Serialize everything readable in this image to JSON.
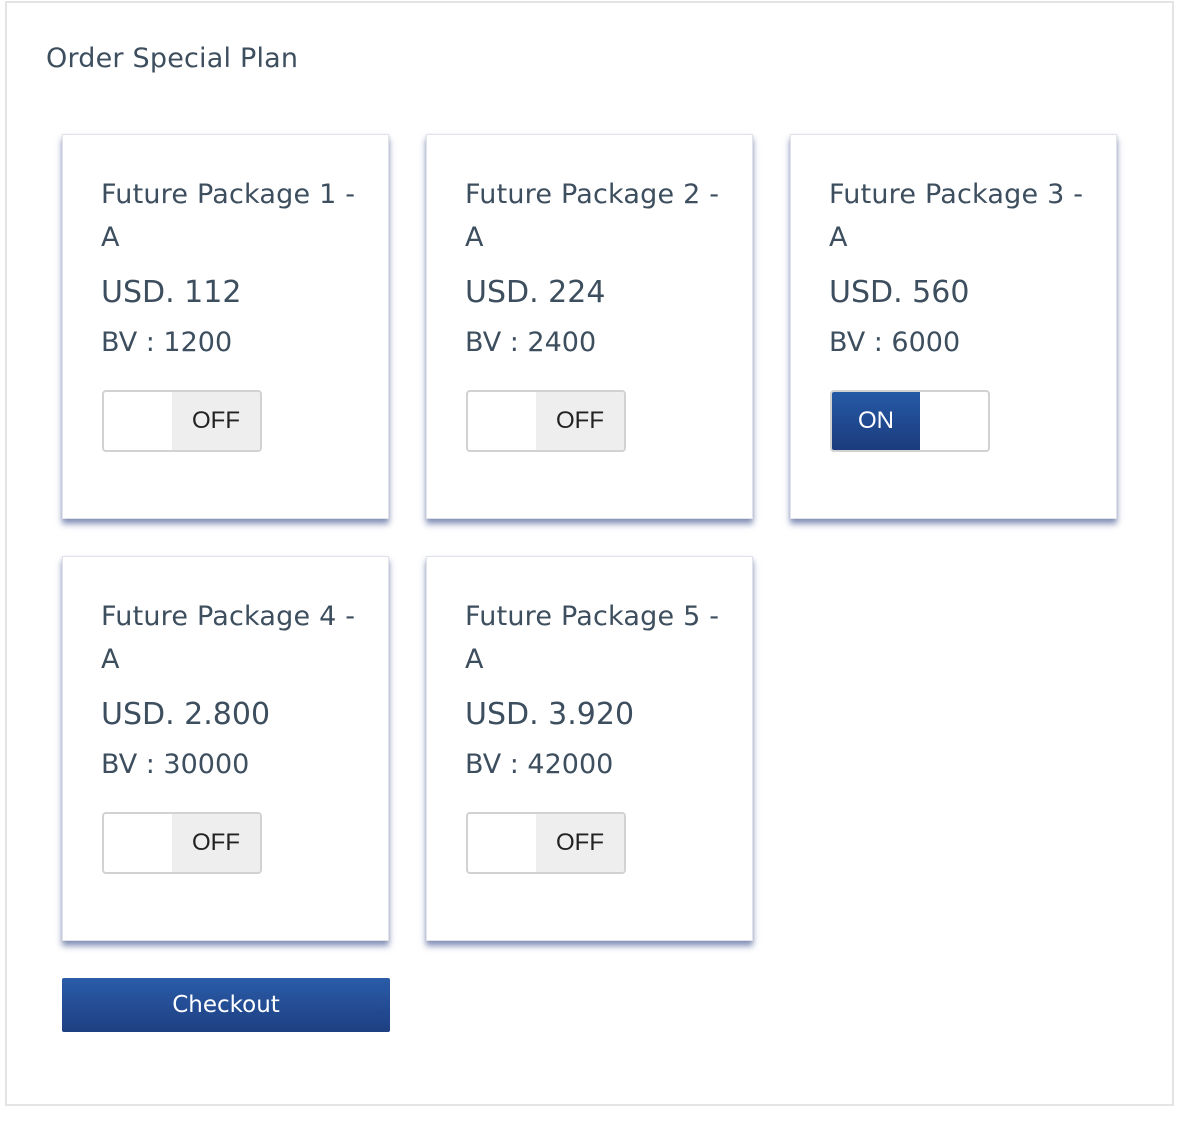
{
  "page": {
    "title": "Order Special Plan"
  },
  "packages": [
    {
      "title": "Future Package 1 - A",
      "price": "USD. 112",
      "bv": "BV : 1200",
      "toggle": "OFF",
      "state": "off"
    },
    {
      "title": "Future Package 2 - A",
      "price": "USD. 224",
      "bv": "BV : 2400",
      "toggle": "OFF",
      "state": "off"
    },
    {
      "title": "Future Package 3 - A",
      "price": "USD. 560",
      "bv": "BV : 6000",
      "toggle": "ON",
      "state": "on"
    },
    {
      "title": "Future Package 4 - A",
      "price": "USD. 2.800",
      "bv": "BV : 30000",
      "toggle": "OFF",
      "state": "off"
    },
    {
      "title": "Future Package 5 - A",
      "price": "USD. 3.920",
      "bv": "BV : 42000",
      "toggle": "OFF",
      "state": "off"
    }
  ],
  "actions": {
    "checkout_label": "Checkout"
  },
  "colors": {
    "accent": "#1e4a94",
    "text": "#3d4e5e",
    "toggle_off_bg": "#eeeeee"
  }
}
